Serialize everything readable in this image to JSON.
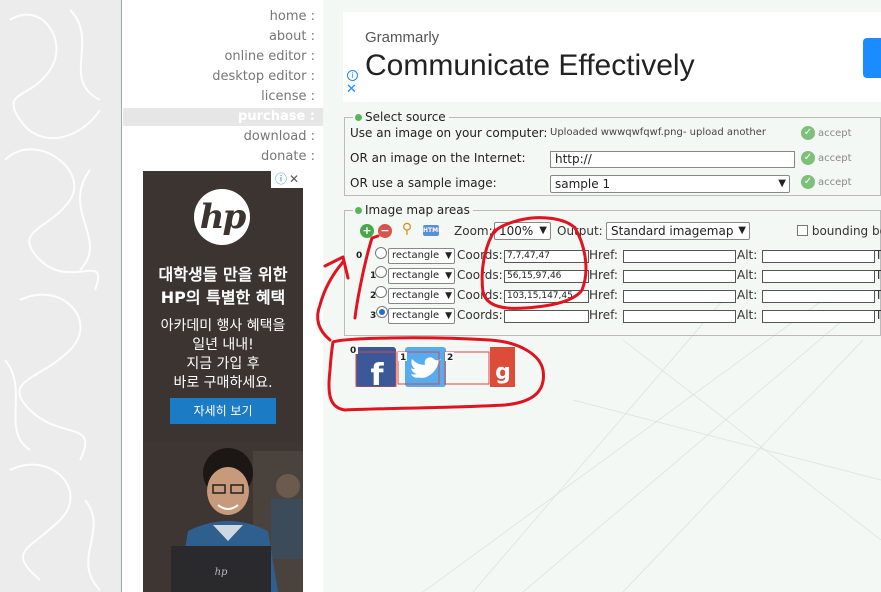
{
  "nav": {
    "items": [
      {
        "label": "home :",
        "active": false
      },
      {
        "label": "about :",
        "active": false
      },
      {
        "label": "online editor :",
        "active": false
      },
      {
        "label": "desktop editor :",
        "active": false
      },
      {
        "label": "license :",
        "active": false
      },
      {
        "label": "purchase :",
        "active": true
      },
      {
        "label": "download :",
        "active": false
      },
      {
        "label": "donate :",
        "active": false
      }
    ]
  },
  "hp_ad": {
    "logo": "hp",
    "headline_1": "대학생들 만을 위한",
    "headline_2": "HP의 특별한 혜택",
    "sub_1": "아카데미 행사 혜택을",
    "sub_2": "일년 내내!",
    "sub_3": "지금 가입 후",
    "sub_4": "바로 구매하세요.",
    "button": "자세히 보기"
  },
  "grammarly_ad": {
    "brand": "Grammarly",
    "headline": "Communicate Effectively"
  },
  "source": {
    "legend": "Select source",
    "computer_label": "Use an image on your computer:",
    "uploaded_text": "Uploaded wwwqwfqwf.png-",
    "upload_another": "upload another",
    "internet_label": "OR an image on the Internet:",
    "internet_value": "http://",
    "sample_label": "OR use a sample image:",
    "sample_value": "sample 1",
    "accept_label": "accept"
  },
  "areas": {
    "legend": "Image map areas",
    "zoom_label": "Zoom:",
    "zoom_value": "100%",
    "output_label": "Output:",
    "output_value": "Standard imagemap",
    "bounding_label": "bounding bo",
    "coords_label": "Coords:",
    "href_label": "Href:",
    "alt_label": "Alt:",
    "trailing_label": "T",
    "rows": [
      {
        "index": "0",
        "shape": "rectangle",
        "coords": "7,7,47,47",
        "selected": false
      },
      {
        "index": "1",
        "shape": "rectangle",
        "coords": "56,15,97,46",
        "selected": false
      },
      {
        "index": "2",
        "shape": "rectangle",
        "coords": "103,15,147,45",
        "selected": false
      },
      {
        "index": "3",
        "shape": "rectangle",
        "coords": "",
        "selected": true
      }
    ]
  },
  "preview": {
    "labels": [
      "0",
      "1",
      "2"
    ]
  },
  "colors": {
    "accent_green": "#5ab55a",
    "annotation_red": "#e0141e",
    "facebook": "#3b5998",
    "twitter": "#55acee",
    "google": "#dd4b39"
  },
  "icons": [
    "add-icon",
    "remove-icon",
    "zoom-icon",
    "html-icon",
    "accept-icon",
    "adchoices-icon"
  ]
}
